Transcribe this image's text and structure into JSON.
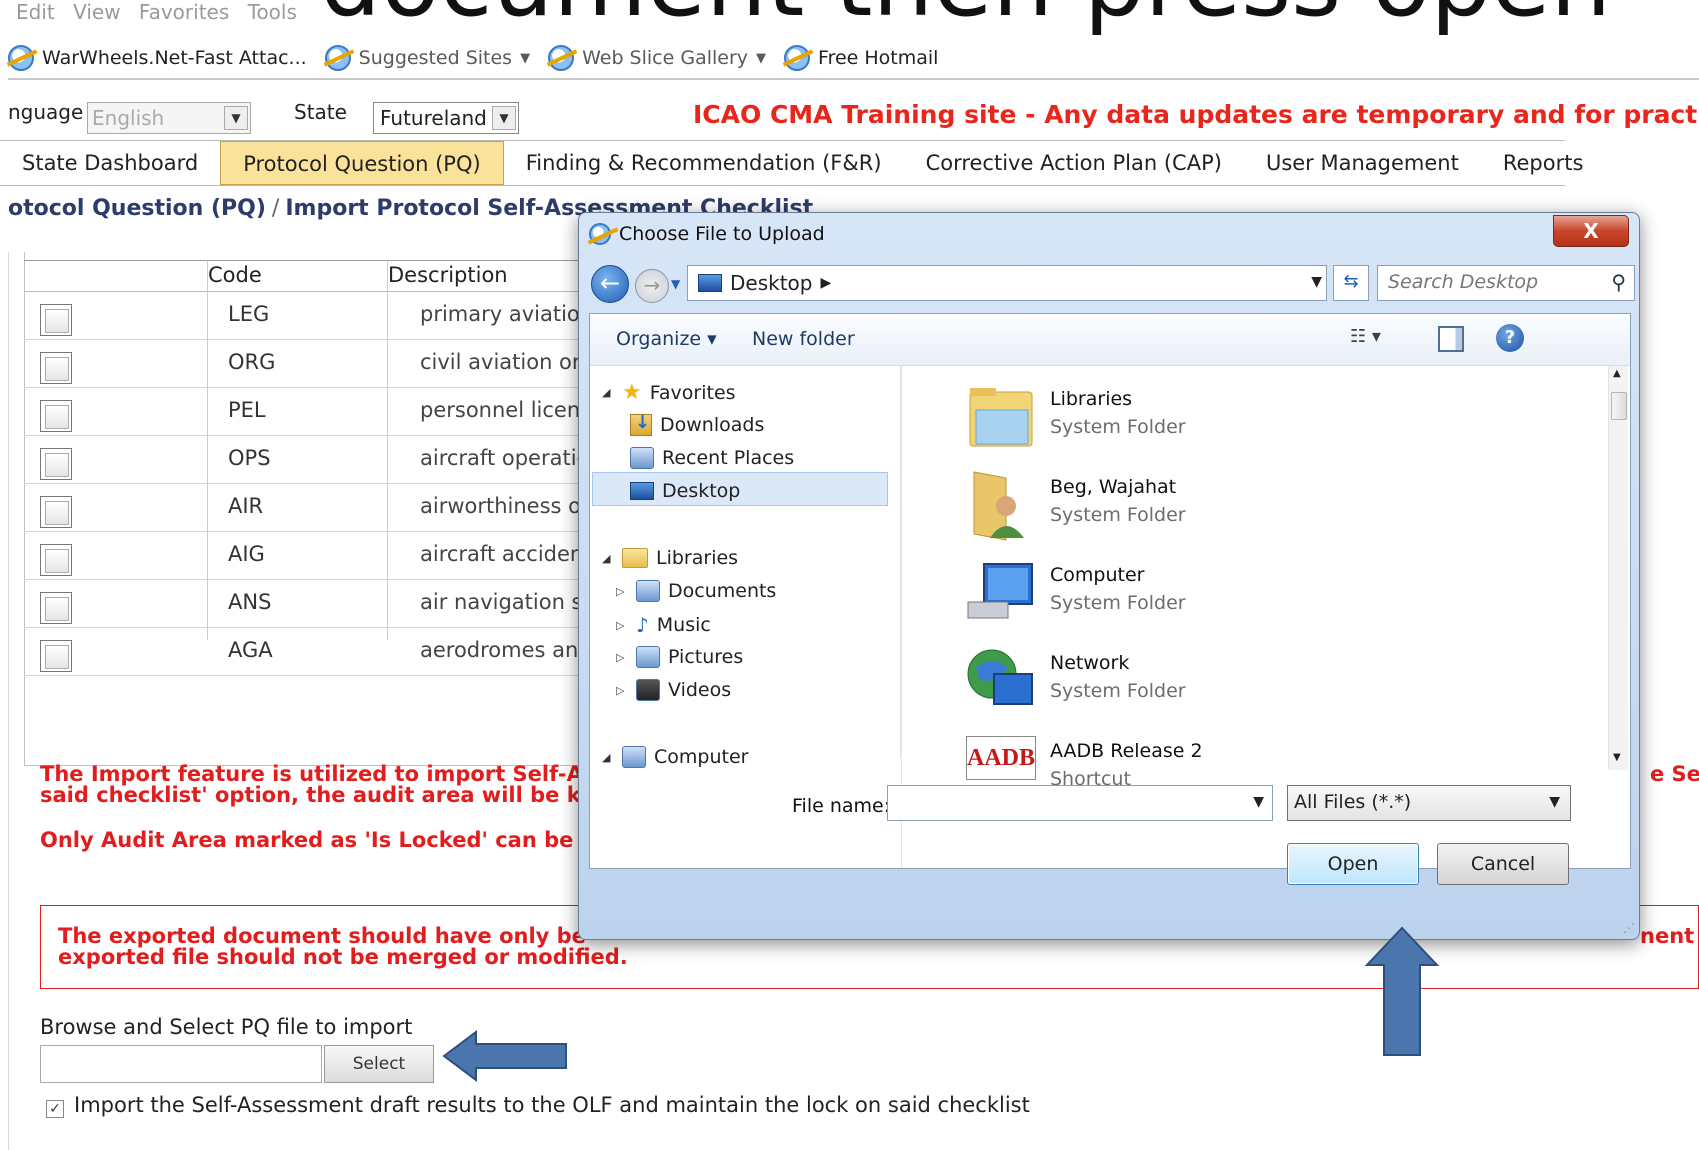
{
  "slide_caption": "document then press open",
  "browser": {
    "menu_items": [
      "Edit",
      "View",
      "Favorites",
      "Tools"
    ],
    "favorites": [
      {
        "label": "WarWheels.Net-Fast Attac...",
        "has_dropdown": false
      },
      {
        "label": "Suggested Sites",
        "has_dropdown": true
      },
      {
        "label": "Web Slice Gallery",
        "has_dropdown": true
      },
      {
        "label": "Free Hotmail",
        "has_dropdown": false
      }
    ]
  },
  "header": {
    "language_label": "nguage",
    "language_value": "English",
    "state_label": "State",
    "state_value": "Futureland",
    "banner": "ICAO CMA Training site - Any data updates are temporary and for practice"
  },
  "tabs": [
    {
      "label": "State Dashboard",
      "active": false
    },
    {
      "label": "Protocol Question (PQ)",
      "active": true
    },
    {
      "label": "Finding & Recommendation (F&R)",
      "active": false
    },
    {
      "label": "Corrective Action Plan (CAP)",
      "active": false
    },
    {
      "label": "User Management",
      "active": false
    },
    {
      "label": "Reports",
      "active": false
    }
  ],
  "breadcrumb": {
    "parent": "otocol Question (PQ)",
    "separator": "/",
    "current": "Import Protocol Self-Assessment Checklist"
  },
  "table": {
    "headers": {
      "code": "Code",
      "description": "Description"
    },
    "rows": [
      {
        "code": "LEG",
        "description": "primary aviation"
      },
      {
        "code": "ORG",
        "description": "civil aviation org"
      },
      {
        "code": "PEL",
        "description": "personnel licens"
      },
      {
        "code": "OPS",
        "description": "aircraft operatio"
      },
      {
        "code": "AIR",
        "description": "airworthiness of"
      },
      {
        "code": "AIG",
        "description": "aircraft acciden"
      },
      {
        "code": "ANS",
        "description": "air navigation s"
      },
      {
        "code": "AGA",
        "description": "aerodromes and"
      }
    ]
  },
  "notices": {
    "import_line1": "The Import feature is utilized to import Self-As",
    "import_line1_right": "e Se",
    "import_line2": "said checklist' option, the audit area will be ke",
    "locked": "Only Audit Area marked as 'Is Locked' can be i",
    "warn_line1": "The exported document should have only be",
    "warn_line1_right": "nent",
    "warn_line2": "exported file should not be merged or modified."
  },
  "import_form": {
    "browse_label": "Browse and Select PQ file to import",
    "file_value": "",
    "select_button": "Select",
    "checkbox_checked": true,
    "checkbox_label": "Import the Self-Assessment draft results to the OLF and maintain the lock on said checklist"
  },
  "dialog": {
    "title": "Choose File to Upload",
    "close_label": "X",
    "address": "Desktop",
    "search_placeholder": "Search Desktop",
    "organize_label": "Organize",
    "new_folder_label": "New folder",
    "nav_tree": [
      {
        "label": "Favorites",
        "icon": "star-icon",
        "level": 0,
        "expanded": true
      },
      {
        "label": "Downloads",
        "icon": "downloads-icon",
        "level": 1
      },
      {
        "label": "Recent Places",
        "icon": "recent-places-icon",
        "level": 1
      },
      {
        "label": "Desktop",
        "icon": "desktop-icon",
        "level": 1,
        "selected": true
      },
      {
        "label": "Libraries",
        "icon": "libraries-icon",
        "level": 0,
        "expanded": true
      },
      {
        "label": "Documents",
        "icon": "documents-icon",
        "level": 1
      },
      {
        "label": "Music",
        "icon": "music-icon",
        "level": 1
      },
      {
        "label": "Pictures",
        "icon": "pictures-icon",
        "level": 1
      },
      {
        "label": "Videos",
        "icon": "videos-icon",
        "level": 1
      },
      {
        "label": "Computer",
        "icon": "computer-icon",
        "level": 0,
        "expanded": true
      }
    ],
    "files": [
      {
        "name": "Libraries",
        "type": "System Folder",
        "icon": "libraries-folder-icon"
      },
      {
        "name": "Beg, Wajahat",
        "type": "System Folder",
        "icon": "user-folder-icon"
      },
      {
        "name": "Computer",
        "type": "System Folder",
        "icon": "computer-icon"
      },
      {
        "name": "Network",
        "type": "System Folder",
        "icon": "network-icon"
      },
      {
        "name": "AADB Release 2",
        "type": "Shortcut",
        "icon": "aadb-shortcut-icon",
        "icon_text": "AADB"
      }
    ],
    "file_name_label": "File name:",
    "file_name_value": "",
    "filter_value": "All Files (*.*)",
    "open_button": "Open",
    "cancel_button": "Cancel"
  },
  "colors": {
    "banner_red": "#e8261b",
    "active_tab": "#fbe29a",
    "arrow_blue": "#4a76ad",
    "notice_red": "#e11d1d"
  }
}
